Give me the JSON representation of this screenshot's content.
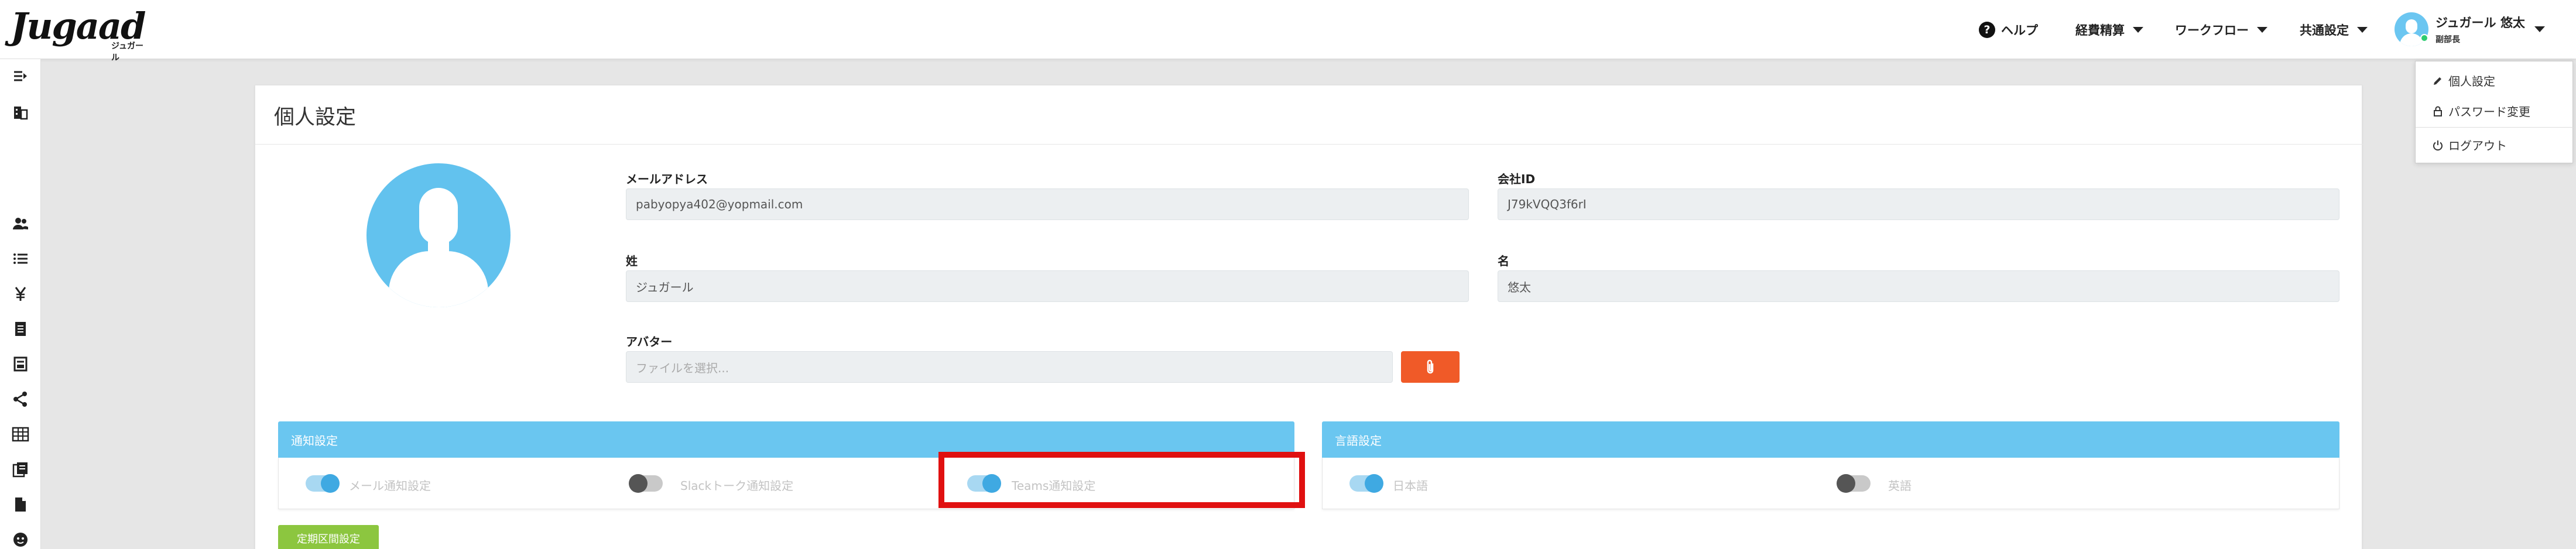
{
  "header": {
    "logo_text": "Jugaad",
    "logo_sub": "ジュガール",
    "help_label": "ヘルプ",
    "menu": [
      {
        "label": "経費精算"
      },
      {
        "label": "ワークフロー"
      },
      {
        "label": "共通設定"
      }
    ],
    "user_name": "ジュガール 悠太",
    "user_role": "副部長"
  },
  "dropdown": {
    "items": [
      {
        "label": "個人設定",
        "icon": "pencil-icon"
      },
      {
        "label": "パスワード変更",
        "icon": "lock-icon"
      },
      {
        "label": "ログアウト",
        "icon": "power-icon"
      }
    ]
  },
  "sidebar": {
    "icons": [
      "expand-icon",
      "building-icon",
      "users-icon",
      "list-icon",
      "yen-icon",
      "document-icon",
      "receipt-icon",
      "share-icon",
      "table-icon",
      "copy-icon",
      "file-icon",
      "face-icon"
    ]
  },
  "page": {
    "title": "個人設定"
  },
  "form": {
    "email_label": "メールアドレス",
    "email_value": "pabyopya402@yopmail.com",
    "company_id_label": "会社ID",
    "company_id_value": "J79kVQQ3f6rI",
    "last_name_label": "姓",
    "last_name_value": "ジュガール",
    "first_name_label": "名",
    "first_name_value": "悠太",
    "avatar_label": "アバター",
    "avatar_placeholder": "ファイルを選択..."
  },
  "notifications": {
    "title": "通知設定",
    "toggles": [
      {
        "label": "メール通知設定",
        "on": true
      },
      {
        "label": "Slackトーク通知設定",
        "on": false
      },
      {
        "label": "Teams通知設定",
        "on": true
      }
    ]
  },
  "language": {
    "title": "言語設定",
    "toggles": [
      {
        "label": "日本語",
        "on": true
      },
      {
        "label": "英語",
        "on": false
      }
    ]
  },
  "bottom_button": "定期区間設定",
  "colors": {
    "accent": "#6ac6f0",
    "highlight": "#e01010",
    "attach_button": "#f05a28",
    "green_button": "#8cc63f"
  }
}
